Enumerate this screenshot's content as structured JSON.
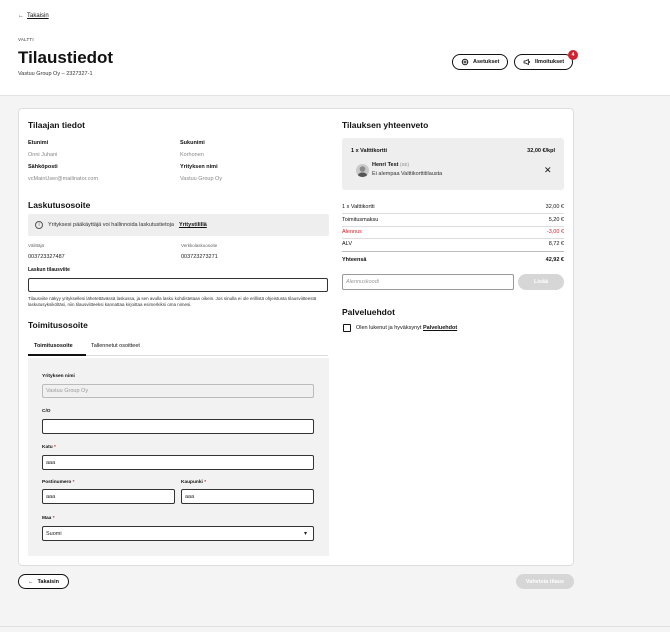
{
  "nav": {
    "back_label": "Takaisin"
  },
  "header": {
    "eyebrow": "VALTTI",
    "title": "Tilaustiedot",
    "subtitle": "Vastuu Group Oy – 2327327-1",
    "settings_label": "Asetukset",
    "notifications_label": "Ilmoitukset",
    "notifications_count": "4"
  },
  "orderer": {
    "heading": "Tilaajan tiedot",
    "first_name_label": "Etunimi",
    "first_name": "Onni Juhani",
    "last_name_label": "Sukunimi",
    "last_name": "Korhonen",
    "email_label": "Sähköposti",
    "email": "vcMainUser@mailinator.com",
    "company_label": "Yrityksen nimi",
    "company": "Vastuu Group Oy"
  },
  "billing": {
    "heading": "Laskutusosoite",
    "info_text": "Yrityksesi pääkäyttäjä voi hallinnoida laskutustietoja",
    "info_link": "Yritystilillä",
    "operator_label": "Välittäjä",
    "operator": "003723327487",
    "einvoice_label": "Verkkolaskuosoite",
    "einvoice": "003723273271",
    "reference_label": "Laskun tilausviite",
    "reference_value": "",
    "note": "Tilausviite näkyy yrityksellesi lähetettävässä laskussa, ja sen avulla lasku kohdistetaan oikein. Jos sinulla ei ole erillistä ohjeistusta tilausviitteestä laskutusyksiköltäsi, niin tilausviitteeksi kannattaa kirjoittaa esimerkiksi oma nimesi."
  },
  "delivery": {
    "heading": "Toimitusosoite",
    "tab_address": "Toimitusosoite",
    "tab_saved": "Tallennetut osoitteet",
    "company_label": "Yrityksen nimi",
    "company_value": "Vastuu Group Oy",
    "co_label": "C/O",
    "co_value": "",
    "street_label": "Katu",
    "street_value": "aaa",
    "postal_label": "Postinumero",
    "postal_value": "aaa",
    "city_label": "Kaupunki",
    "city_value": "aaa",
    "country_label": "Maa",
    "country_value": "Suomi",
    "required_mark": "*"
  },
  "summary": {
    "heading": "Tilauksen yhteenveto",
    "item_label": "1 x Valttikortti",
    "item_price": "32,00 €/kpl",
    "person_name": "Henri Test",
    "person_tag": "(SE)",
    "person_status": "Ei alempaa Valttikorttitilausta",
    "lines": [
      {
        "label": "1 x Valttikortti",
        "value": "32,00 €"
      },
      {
        "label": "Toimitusmaksu",
        "value": "5,20 €"
      },
      {
        "label": "Alennus",
        "value": "-3,00 €"
      },
      {
        "label": "ALV",
        "value": "8,72 €"
      }
    ],
    "total_label": "Yhteensä",
    "total_value": "42,92 €",
    "discount_placeholder": "Alennuskoodi",
    "discount_button": "Lisää"
  },
  "terms": {
    "heading": "Palveluehdot",
    "text": "Olen lukenut ja hyväksynyt",
    "link": "Palveluehdot"
  },
  "footer": {
    "back_label": "Takaisin",
    "confirm_label": "Vahvista tilaus"
  },
  "colors": {
    "accent_red": "#d0232f",
    "disabled_grey": "#d6d6d6"
  }
}
